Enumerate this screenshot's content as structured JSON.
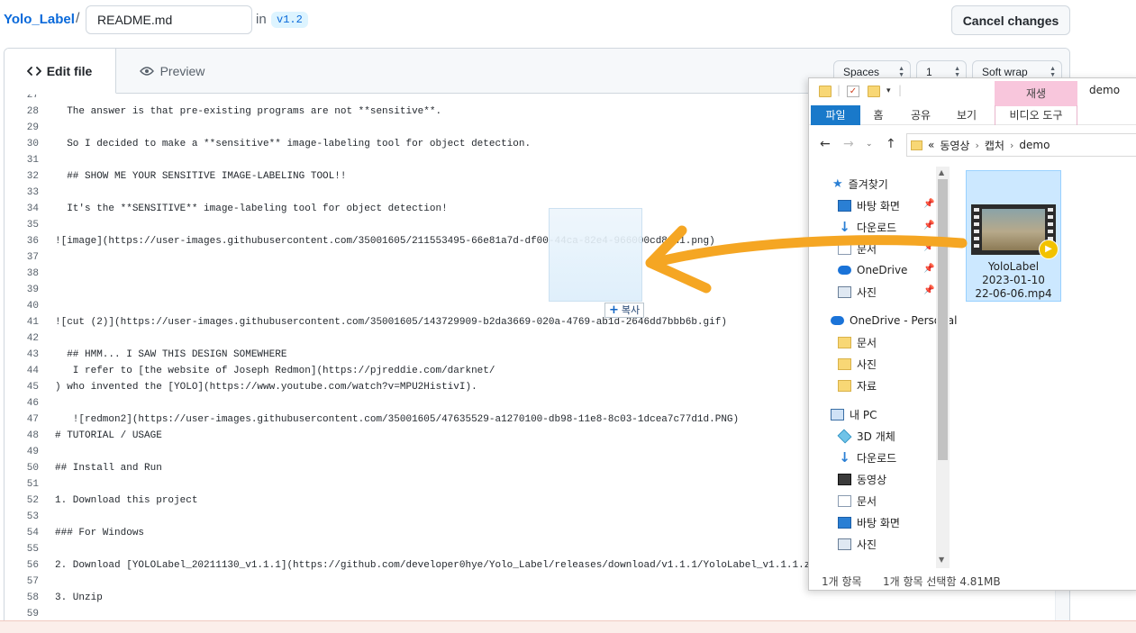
{
  "github": {
    "repo": "Yolo_Label",
    "slash": "/",
    "filename": "README.md",
    "in_label": "in",
    "branch": "v1.2",
    "cancel_label": "Cancel changes",
    "tabs": {
      "edit": "Edit file",
      "preview": "Preview"
    },
    "selects": {
      "indent_mode": "Spaces",
      "indent_size": "1",
      "wrap_mode": "Soft wrap"
    }
  },
  "editor": {
    "lines": [
      {
        "n": "27",
        "t": ""
      },
      {
        "n": "28",
        "t": "  The answer is that pre-existing programs are not **sensitive**."
      },
      {
        "n": "29",
        "t": ""
      },
      {
        "n": "30",
        "t": "  So I decided to make a **sensitive** image-labeling tool for object detection."
      },
      {
        "n": "31",
        "t": ""
      },
      {
        "n": "32",
        "t": "  ## SHOW ME YOUR SENSITIVE IMAGE-LABELING TOOL!!"
      },
      {
        "n": "33",
        "t": ""
      },
      {
        "n": "34",
        "t": "  It's the **SENSITIVE** image-labeling tool for object detection!"
      },
      {
        "n": "35",
        "t": ""
      },
      {
        "n": "36",
        "t": "![image](https://user-images.githubusercontent.com/35001605/211553495-66e81a7d-df00-44ca-82e4-966000cd8cd1.png)"
      },
      {
        "n": "37",
        "t": ""
      },
      {
        "n": "38",
        "t": ""
      },
      {
        "n": "39",
        "t": ""
      },
      {
        "n": "40",
        "t": ""
      },
      {
        "n": "41",
        "t": "![cut (2)](https://user-images.githubusercontent.com/35001605/143729909-b2da3669-020a-4769-ab1d-2646dd7bbb6b.gif)"
      },
      {
        "n": "42",
        "t": ""
      },
      {
        "n": "43",
        "t": "  ## HMM... I SAW THIS DESIGN SOMEWHERE"
      },
      {
        "n": "44",
        "t": "   I refer to [the website of Joseph Redmon](https://pjreddie.com/darknet/"
      },
      {
        "n": "45",
        "t": ") who invented the [YOLO](https://www.youtube.com/watch?v=MPU2HistivI)."
      },
      {
        "n": "46",
        "t": ""
      },
      {
        "n": "47",
        "t": "   ![redmon2](https://user-images.githubusercontent.com/35001605/47635529-a1270100-db98-11e8-8c03-1dcea7c77d1d.PNG)"
      },
      {
        "n": "48",
        "t": "# TUTORIAL / USAGE"
      },
      {
        "n": "49",
        "t": ""
      },
      {
        "n": "50",
        "t": "## Install and Run"
      },
      {
        "n": "51",
        "t": ""
      },
      {
        "n": "52",
        "t": "1. Download this project"
      },
      {
        "n": "53",
        "t": ""
      },
      {
        "n": "54",
        "t": "### For Windows"
      },
      {
        "n": "55",
        "t": ""
      },
      {
        "n": "56",
        "t": "2. Download [YOLOLabel_20211130_v1.1.1](https://github.com/developer0hye/Yolo_Label/releases/download/v1.1.1/YoloLabel_v1.1.1.zip)"
      },
      {
        "n": "57",
        "t": ""
      },
      {
        "n": "58",
        "t": "3. Unzip"
      },
      {
        "n": "59",
        "t": ""
      }
    ]
  },
  "drag": {
    "copy_label": "복사",
    "copy_icon": "plus-icon"
  },
  "arrow": {
    "color": "#F5A623"
  },
  "explorer": {
    "context_tab": "재생",
    "window_title": "demo",
    "ribbon_tabs": [
      "파일",
      "홈",
      "공유",
      "보기"
    ],
    "ribbon_context": "비디오 도구",
    "breadcrumb": [
      "«",
      "동영상",
      "캡처",
      "demo"
    ],
    "nav": {
      "quick_access": "즐겨찾기",
      "qa_items": [
        "바탕 화면",
        "다운로드",
        "문서",
        "OneDrive",
        "사진"
      ],
      "onedrive": "OneDrive - Personal",
      "od_items": [
        "문서",
        "사진",
        "자료"
      ],
      "this_pc": "내 PC",
      "pc_items": [
        "3D 개체",
        "다운로드",
        "동영상",
        "문서",
        "바탕 화면",
        "사진"
      ]
    },
    "file": {
      "name": "YoloLabel\n2023-01-10\n22-06-06.mp4"
    },
    "status": {
      "count": "1개 항목",
      "selected": "1개 항목 선택함 4.81MB"
    }
  }
}
